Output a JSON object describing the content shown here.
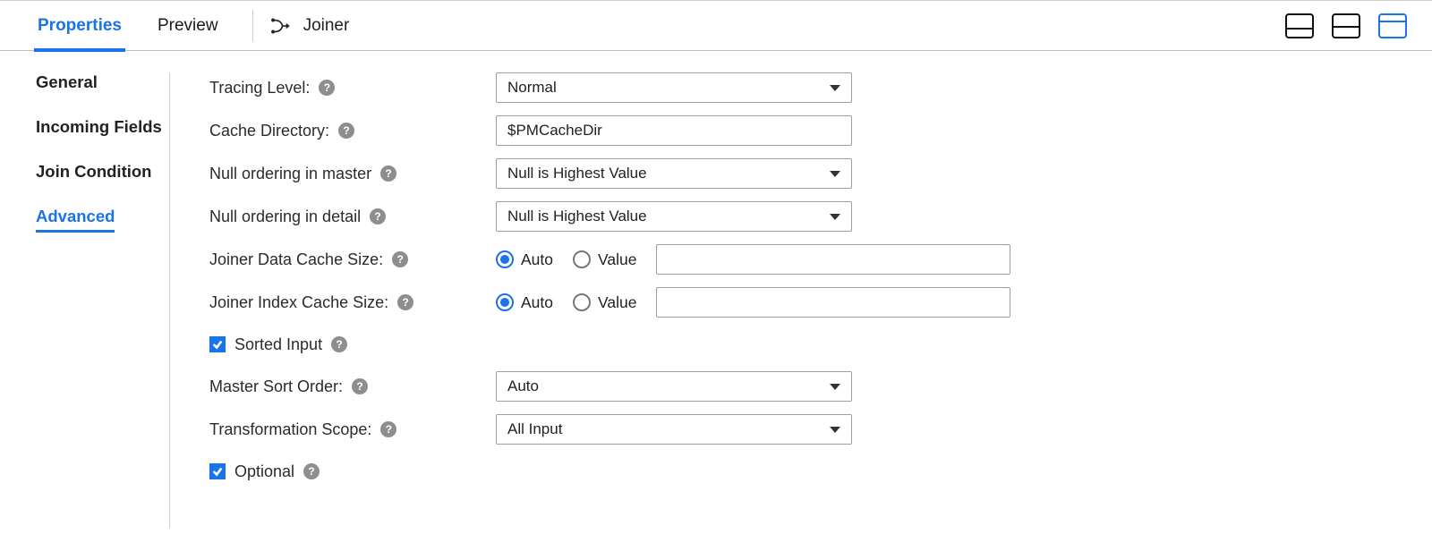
{
  "tabs": {
    "properties": "Properties",
    "preview": "Preview"
  },
  "transformation": {
    "name": "Joiner"
  },
  "sections": {
    "general": "General",
    "incomingFields": "Incoming Fields",
    "joinCondition": "Join Condition",
    "advanced": "Advanced"
  },
  "labels": {
    "tracingLevel": "Tracing Level:",
    "cacheDirectory": "Cache Directory:",
    "nullOrderingMaster": "Null ordering in master",
    "nullOrderingDetail": "Null ordering in detail",
    "joinerDataCache": "Joiner Data Cache Size:",
    "joinerIndexCache": "Joiner Index Cache Size:",
    "sortedInput": "Sorted Input",
    "masterSortOrder": "Master Sort Order:",
    "transformationScope": "Transformation Scope:",
    "optional": "Optional",
    "auto": "Auto",
    "value": "Value"
  },
  "values": {
    "tracingLevel": "Normal",
    "cacheDirectory": "$PMCacheDir",
    "nullOrderingMaster": "Null is Highest Value",
    "nullOrderingDetail": "Null is Highest Value",
    "joinerDataCacheMode": "Auto",
    "joinerDataCacheValue": "",
    "joinerIndexCacheMode": "Auto",
    "joinerIndexCacheValue": "",
    "sortedInput": true,
    "masterSortOrder": "Auto",
    "transformationScope": "All Input",
    "optional": true
  }
}
